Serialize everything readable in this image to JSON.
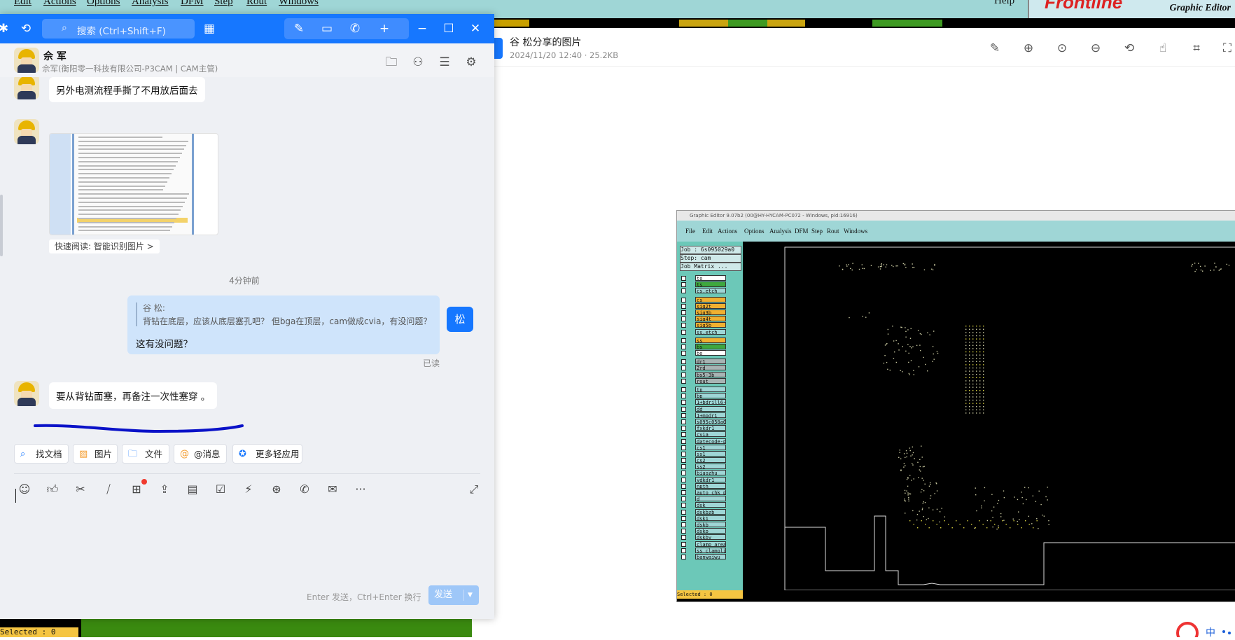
{
  "background_app": {
    "menus": [
      "Edit",
      "Actions",
      "Options",
      "Analysis",
      "DFM",
      "Step",
      "Rout",
      "Windows"
    ],
    "help": "Help",
    "brand": "Frontline",
    "app_title": "Graphic Editor",
    "selected_label": "Selected : 0"
  },
  "chat": {
    "search_placeholder": "搜索 (Ctrl+Shift+F)",
    "contact": {
      "name": "佘 军",
      "subtitle": "佘军(衡阳零一科技有限公司-P3CAM | CAM主管)"
    },
    "messages": {
      "m1_text": "另外电测流程手撕了不用放后面去",
      "quick_read": "快速阅读: 智能识别图片 >",
      "timestamp": "4分钟前",
      "quote_name": "谷 松:",
      "quote_text": "背钻在底层，应该从底层塞孔吧？  但bga在顶层，cam做成cvia，有没问题？",
      "reply_text": "这有没问题？",
      "my_avatar_text": "松",
      "read_status": "已读",
      "m2_text": "要从背钻面塞，再备注一次性塞穿 。"
    },
    "quick_tools": [
      "找文档",
      "图片",
      "文件",
      "@消息",
      "更多轻应用"
    ],
    "input_hint": "Enter 发送，Ctrl+Enter 换行",
    "send_label": "发送"
  },
  "viewer": {
    "title": "谷 松分享的图片",
    "meta": "2024/11/20 12:40 · 25.2KB"
  },
  "screenshot": {
    "window_title": "Graphic Editor 9.07b2 (00@HY-HYCAM-PC072 - Windows, pid:16916)",
    "menus": [
      "File",
      "Edit",
      "Actions",
      "Options",
      "Analysis",
      "DFM",
      "Step",
      "Rout",
      "Windows"
    ],
    "job": "Job : 6s095029a0",
    "step": "Step: cam",
    "job_matrix": "Job Matrix ...",
    "layers": [
      "to",
      "ts",
      "cs.etch",
      "cs",
      "sig2t",
      "sig3b",
      "sig4t",
      "sig5b",
      "ss.etch",
      "ss",
      "bs",
      "bo",
      "dr1",
      "2rd",
      "bs5-3b",
      "rout",
      "tp",
      "bp",
      "1+bdrill6-3",
      "dd",
      "1+mpdr1",
      "s095c050a0",
      "fxkdr1",
      "cvia",
      "datecode-pth",
      "cs1",
      "ss1",
      "cs2",
      "ss2",
      "biaozhu",
      "ydkdr1",
      "npth",
      "auto_chk_pn",
      "d",
      "dsk",
      "dskbzb",
      "dsk1",
      "dskb",
      "dskp",
      "dskby",
      "clamp_area",
      "ss_clamplin",
      "banwaiwu"
    ],
    "selected": "Selected : 0"
  },
  "colors": {
    "accent": "#1677ff",
    "bubble_mine": "#cfe4fb",
    "chat_bg": "#eef0f4",
    "legacy_teal": "#9fd6d6"
  }
}
